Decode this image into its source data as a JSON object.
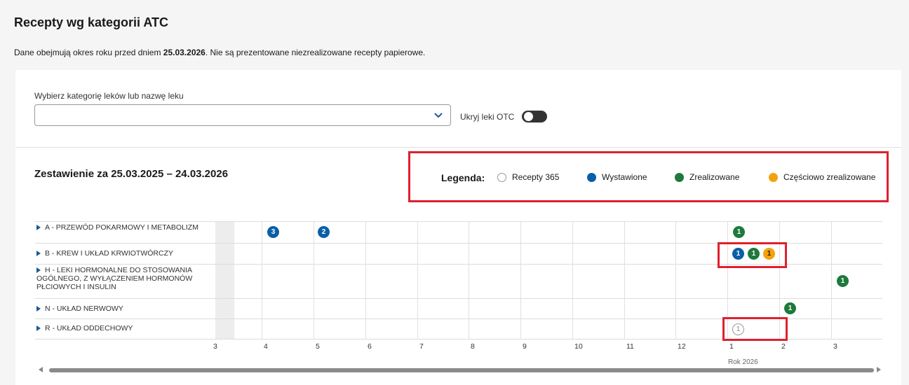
{
  "page": {
    "title": "Recepty wg kategorii ATC",
    "desc_prefix": "Dane obejmują okres roku przed dniem ",
    "desc_date": "25.03.2026",
    "desc_suffix": ". Nie są prezentowane niezrealizowane recepty papierowe."
  },
  "filter": {
    "label": "Wybierz kategorię leków lub nazwę leku",
    "value": "",
    "otc_label": "Ukryj leki OTC"
  },
  "summary": {
    "period": "Zestawienie za 25.03.2025 – 24.03.2026"
  },
  "legend": {
    "title": "Legenda:",
    "items": [
      {
        "label": "Recepty 365",
        "color": "#ffffff",
        "kind": "outline"
      },
      {
        "label": "Wystawione",
        "color": "#0b5ea8",
        "kind": "blue"
      },
      {
        "label": "Zrealizowane",
        "color": "#1d7a3c",
        "kind": "green"
      },
      {
        "label": "Częściowo zrealizowane",
        "color": "#f3a20c",
        "kind": "orange"
      }
    ]
  },
  "rows": [
    {
      "label": "A - PRZEWÓD POKARMOWY I METABOLIZM"
    },
    {
      "label": "B - KREW I UKŁAD KRWIOTWÓRCZY"
    },
    {
      "label": "H - LEKI HORMONALNE DO STOSOWANIA OGÓLNEGO, Z WYŁĄCZENIEM HORMONÓW PŁCIOWYCH I INSULIN"
    },
    {
      "label": "N - UKŁAD NERWOWY"
    },
    {
      "label": "R - UKŁAD ODDECHOWY"
    }
  ],
  "ticks": [
    "3",
    "4",
    "5",
    "6",
    "7",
    "8",
    "9",
    "10",
    "11",
    "12",
    "1",
    "2",
    "3"
  ],
  "year_label": "Rok 2026",
  "badges": [
    {
      "value": "3",
      "kind": "blue"
    },
    {
      "value": "2",
      "kind": "blue"
    },
    {
      "value": "1",
      "kind": "green"
    },
    {
      "value": "1",
      "kind": "blue"
    },
    {
      "value": "1",
      "kind": "green"
    },
    {
      "value": "1",
      "kind": "orange"
    },
    {
      "value": "1",
      "kind": "green"
    },
    {
      "value": "1",
      "kind": "green"
    },
    {
      "value": "1",
      "kind": "outline"
    }
  ]
}
